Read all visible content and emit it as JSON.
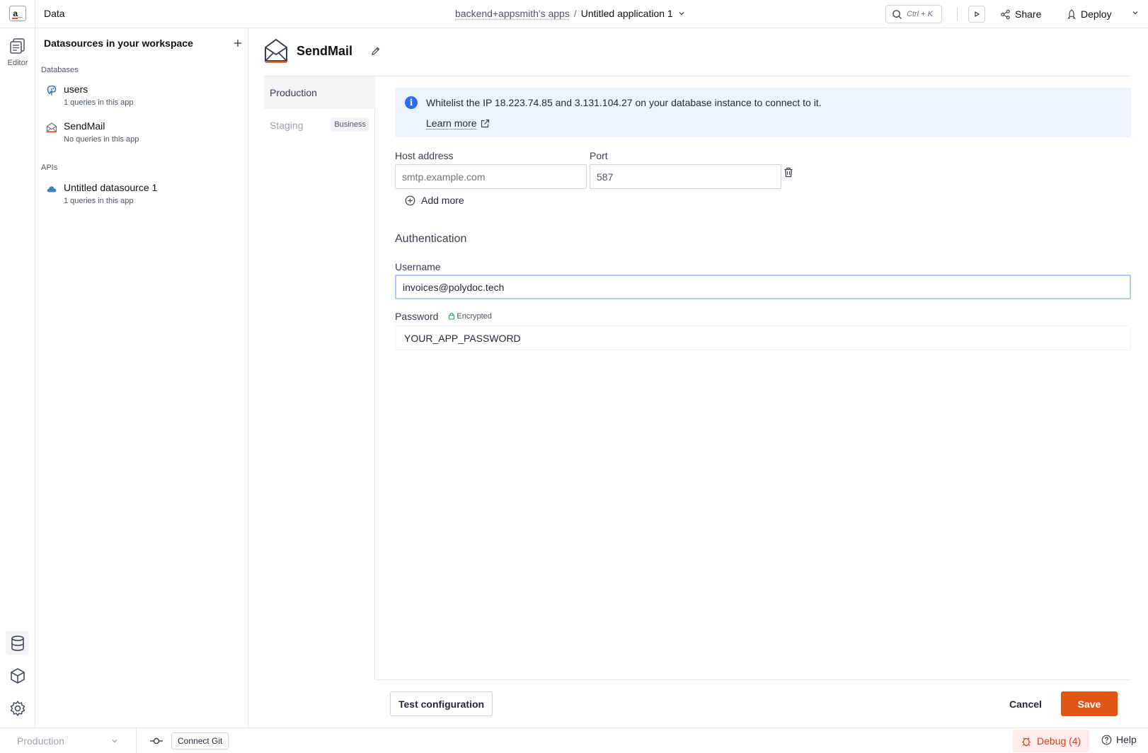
{
  "header": {
    "logo_text": "a_",
    "section_title": "Data",
    "workspace": "backend+appsmith's apps",
    "separator": "/",
    "app_name": "Untitled application 1",
    "search_shortcut": "Ctrl + K",
    "share_label": "Share",
    "deploy_label": "Deploy"
  },
  "rail": {
    "editor_label": "Editor"
  },
  "sidebar": {
    "title": "Datasources in your workspace",
    "databases_label": "Databases",
    "apis_label": "APIs",
    "databases": [
      {
        "name": "users",
        "sub": "1 queries in this app",
        "icon": "postgres-icon"
      },
      {
        "name": "SendMail",
        "sub": "No queries in this app",
        "icon": "mail-icon"
      }
    ],
    "apis": [
      {
        "name": "Untitled datasource 1",
        "sub": "1 queries in this app",
        "icon": "cloud-icon"
      }
    ]
  },
  "datasource": {
    "title": "SendMail",
    "environments": [
      {
        "label": "Production"
      },
      {
        "label": "Staging",
        "badge": "Business"
      }
    ],
    "callout_text": "Whitelist the IP 18.223.74.85 and 3.131.104.27 on your database instance to connect to it.",
    "callout_link": "Learn more",
    "host_label": "Host address",
    "host_placeholder": "smtp.example.com",
    "port_label": "Port",
    "port_value": "587",
    "add_more_label": "Add more",
    "auth_title": "Authentication",
    "username_label": "Username",
    "username_value": "invoices@polydoc.tech",
    "password_label": "Password",
    "encrypted_label": "Encrypted",
    "password_value": "YOUR_APP_PASSWORD",
    "test_button": "Test configuration",
    "cancel_button": "Cancel",
    "save_button": "Save"
  },
  "footer": {
    "environment": "Production",
    "git_button": "Connect Git",
    "debug_label": "Debug (4)",
    "help_label": "Help"
  },
  "colors": {
    "accent": "#e15615",
    "info": "#2c6ef2",
    "callout_bg": "#eef4ff",
    "debug": "#d93d1f"
  }
}
